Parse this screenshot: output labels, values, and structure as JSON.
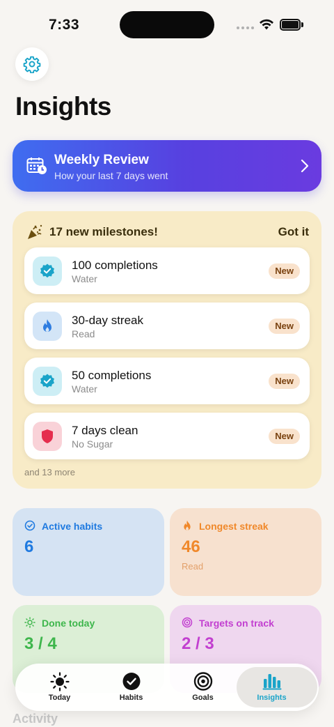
{
  "status_bar": {
    "time": "7:33"
  },
  "header": {
    "title": "Insights"
  },
  "weekly_review": {
    "title": "Weekly Review",
    "subtitle": "How your last 7 days went"
  },
  "milestones": {
    "title": "17 new milestones!",
    "dismiss_label": "Got it",
    "items": [
      {
        "name": "100 completions",
        "habit": "Water",
        "badge": "New",
        "icon": "verified-badge-icon"
      },
      {
        "name": "30-day streak",
        "habit": "Read",
        "badge": "New",
        "icon": "flame-icon"
      },
      {
        "name": "50 completions",
        "habit": "Water",
        "badge": "New",
        "icon": "verified-badge-icon"
      },
      {
        "name": "7 days clean",
        "habit": "No Sugar",
        "badge": "New",
        "icon": "shield-icon"
      }
    ],
    "more_text": "and 13 more"
  },
  "stats": {
    "active_habits": {
      "label": "Active habits",
      "value": "6"
    },
    "longest_streak": {
      "label": "Longest streak",
      "value": "46",
      "sub": "Read"
    },
    "done_today": {
      "label": "Done today",
      "value": "3 / 4"
    },
    "targets_on_track": {
      "label": "Targets on track",
      "value": "2 / 3"
    }
  },
  "section": {
    "activity": "Activity"
  },
  "tabbar": {
    "items": [
      {
        "label": "Today",
        "icon": "sun-icon"
      },
      {
        "label": "Habits",
        "icon": "checkmark-circle-icon"
      },
      {
        "label": "Goals",
        "icon": "target-icon"
      },
      {
        "label": "Insights",
        "icon": "bar-chart-icon"
      }
    ],
    "active": "Insights"
  },
  "colors": {
    "accent": "#1aa4c9",
    "weekly_gradient_start": "#3f6df0",
    "weekly_gradient_end": "#6a3be0",
    "milestones_bg": "#f8ebc7",
    "active_habits_bg": "#d5e3f3",
    "longest_streak_bg": "#f7e1cf",
    "done_today_bg": "#dcefd6",
    "targets_bg": "#efd7ef"
  }
}
